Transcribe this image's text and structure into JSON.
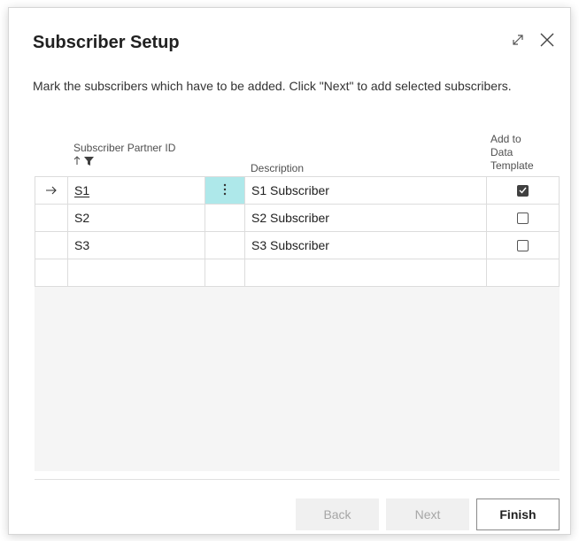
{
  "dialog": {
    "title": "Subscriber Setup",
    "instructions": "Mark the subscribers which have to be added. Click \"Next\" to add selected subscribers."
  },
  "grid": {
    "columns": {
      "partner_id": "Subscriber Partner ID",
      "description": "Description",
      "add_to_template_line1": "Add to",
      "add_to_template_line2": "Data",
      "add_to_template_line3": "Template"
    },
    "rows": [
      {
        "id": "S1",
        "description": "S1 Subscriber",
        "add_to_template": true
      },
      {
        "id": "S2",
        "description": "S2 Subscriber",
        "add_to_template": false
      },
      {
        "id": "S3",
        "description": "S3 Subscriber",
        "add_to_template": false
      }
    ]
  },
  "buttons": {
    "back": "Back",
    "next": "Next",
    "finish": "Finish"
  },
  "icons": {
    "expand": "expand-icon",
    "close": "close-icon",
    "row_selector": "arrow-right-icon",
    "sort": "sort-ascending-icon",
    "filter": "filter-icon",
    "row_actions": "more-vertical-icon"
  },
  "colors": {
    "active_cell": "#aee8ea",
    "grid_background": "#f5f5f5",
    "disabled_button": "#f0f0f0"
  }
}
